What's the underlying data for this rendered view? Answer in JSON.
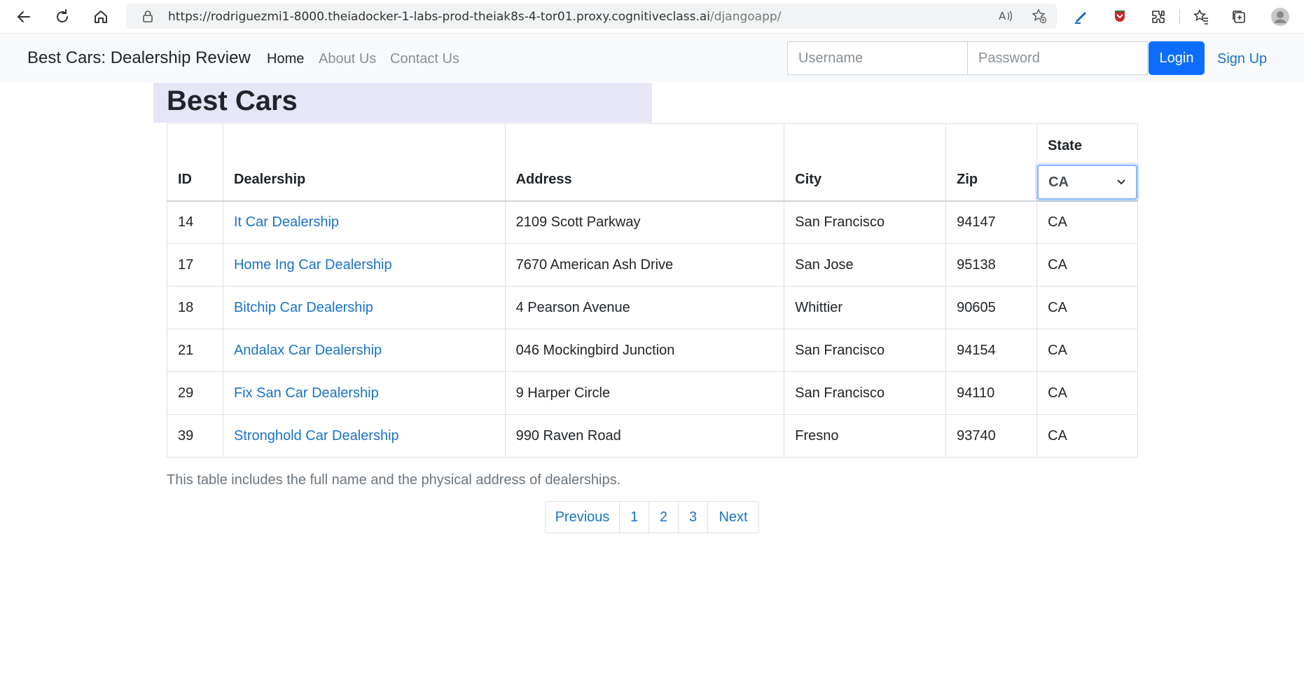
{
  "browser": {
    "url_base": "https://rodriguezmi1-8000.theiadocker-1-labs-prod-theiak8s-4-tor01.proxy.cognitiveclass.ai",
    "url_path": "/djangoapp/"
  },
  "navbar": {
    "brand": "Best Cars: Dealership Review",
    "links": [
      {
        "label": "Home",
        "active": true
      },
      {
        "label": "About Us",
        "active": false
      },
      {
        "label": "Contact Us",
        "active": false
      }
    ],
    "username_placeholder": "Username",
    "password_placeholder": "Password",
    "login_label": "Login",
    "signup_label": "Sign Up"
  },
  "page": {
    "title": "Best Cars"
  },
  "table": {
    "headers": [
      "ID",
      "Dealership",
      "Address",
      "City",
      "Zip",
      "State"
    ],
    "state_filter_value": "CA",
    "rows": [
      {
        "id": "14",
        "name": "It Car Dealership",
        "address": "2109 Scott Parkway",
        "city": "San Francisco",
        "zip": "94147",
        "state": "CA"
      },
      {
        "id": "17",
        "name": "Home Ing Car Dealership",
        "address": "7670 American Ash Drive",
        "city": "San Jose",
        "zip": "95138",
        "state": "CA"
      },
      {
        "id": "18",
        "name": "Bitchip Car Dealership",
        "address": "4 Pearson Avenue",
        "city": "Whittier",
        "zip": "90605",
        "state": "CA"
      },
      {
        "id": "21",
        "name": "Andalax Car Dealership",
        "address": "046 Mockingbird Junction",
        "city": "San Francisco",
        "zip": "94154",
        "state": "CA"
      },
      {
        "id": "29",
        "name": "Fix San Car Dealership",
        "address": "9 Harper Circle",
        "city": "San Francisco",
        "zip": "94110",
        "state": "CA"
      },
      {
        "id": "39",
        "name": "Stronghold Car Dealership",
        "address": "990 Raven Road",
        "city": "Fresno",
        "zip": "93740",
        "state": "CA"
      }
    ],
    "caption": "This table includes the full name and the physical address of dealerships."
  },
  "pagination": {
    "previous": "Previous",
    "pages": [
      "1",
      "2",
      "3"
    ],
    "next": "Next"
  }
}
